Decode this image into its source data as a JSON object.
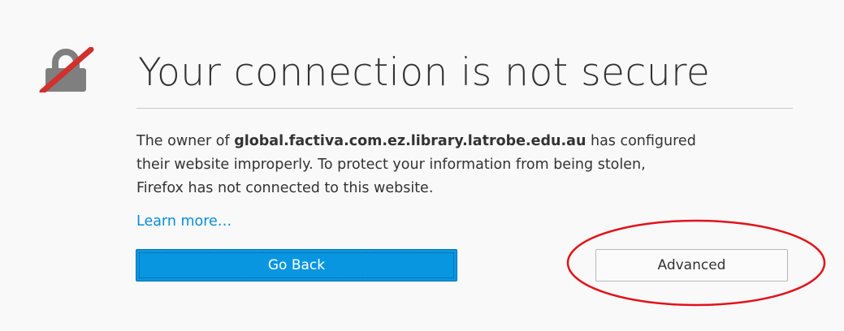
{
  "page": {
    "title": "Your connection is not secure",
    "description": {
      "prefix": "The owner of ",
      "domain": "global.factiva.com.ez.library.latrobe.edu.au",
      "suffix": " has configured",
      "line2": "their website improperly. To protect your information from being stolen,",
      "line3": "Firefox has not connected to this website."
    },
    "learn_more_label": "Learn more…",
    "go_back_label": "Go Back",
    "advanced_label": "Advanced"
  },
  "icons": {
    "lock": "broken-lock-icon"
  },
  "annotation": {
    "type": "red-ellipse",
    "target": "advanced-button"
  },
  "colors": {
    "background": "#f9f9fa",
    "primary_button": "#0996e0",
    "link": "#0a8dd6",
    "lock_gray": "#7f7f7f",
    "lock_slash": "#d0312d",
    "annotation": "#e0141a"
  }
}
